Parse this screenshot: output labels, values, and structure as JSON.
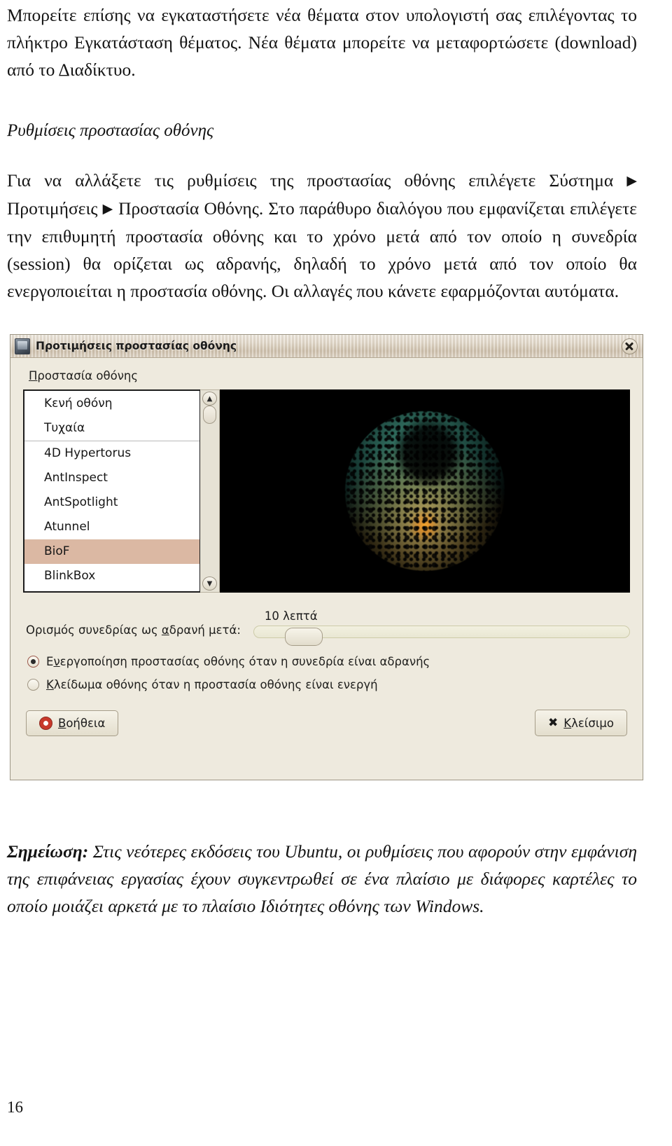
{
  "document": {
    "paragraph_1": "Μπορείτε επίσης να εγκαταστήσετε νέα θέματα στον υπολογιστή σας επιλέγοντας το πλήκτρο Εγκατάσταση θέματος. Νέα θέματα μπορείτε να μεταφορτώσετε (download) από το Διαδίκτυο.",
    "heading": "Ρυθμίσεις προστασίας οθόνης",
    "paragraph_2_a": "Για να αλλάξετε τις ρυθμίσεις της προστασίας οθόνης επιλέγετε Σύστημα",
    "arrow_1": "▶",
    "paragraph_2_b": "Προτιμήσεις",
    "arrow_2": "▶",
    "paragraph_2_c": "Προστασία Οθόνης. Στο παράθυρο διαλόγου που εμφανίζεται επιλέγετε την επιθυμητή προστασία οθόνης και το χρόνο μετά από τον οποίο η συνεδρία (session) θα ορίζεται ως αδρανής, δηλαδή το χρόνο μετά από τον οποίο θα ενεργοποιείται η προστασία οθόνης. Οι αλλαγές που κάνετε εφαρμόζονται αυτόματα.",
    "note_label": "Σημείωση:",
    "note_body": "Στις νεότερες εκδόσεις του Ubuntu, οι ρυθμίσεις που αφορούν στην εμφάνιση της επιφάνειας εργασίας έχουν συγκεντρωθεί σε ένα πλαίσιο με διάφορες καρτέλες το οποίο μοιάζει αρκετά με το πλαίσιο Ιδιότητες οθόνης των Windows.",
    "page_number": "16"
  },
  "dialog": {
    "title": "Προτιμήσεις προστασίας οθόνης",
    "window_icon": "screensaver-icon",
    "close_icon": "✕",
    "group_label": "Προστασία οθόνης",
    "screensaver_list": [
      {
        "label": "Κενή οθόνη",
        "selected": false,
        "separator_after": false
      },
      {
        "label": "Τυχαία",
        "selected": false,
        "separator_after": true
      },
      {
        "label": "4D Hypertorus",
        "selected": false,
        "separator_after": false
      },
      {
        "label": "AntInspect",
        "selected": false,
        "separator_after": false
      },
      {
        "label": "AntSpotlight",
        "selected": false,
        "separator_after": false
      },
      {
        "label": "Atunnel",
        "selected": false,
        "separator_after": false
      },
      {
        "label": "BioF",
        "selected": true,
        "separator_after": false
      },
      {
        "label": "BlinkBox",
        "selected": false,
        "separator_after": false
      }
    ],
    "scroll_up_icon": "▲",
    "scroll_down_icon": "▼",
    "preview_label": "screensaver-preview",
    "idle_label": "Ορισμός συνεδρίας ως αδρανή μετά:",
    "idle_value": "10 λεπτά",
    "option_activate": "Ενεργοποίηση προστασίας οθόνης όταν η συνεδρία είναι αδρανής",
    "option_lock": "Κλείδωμα οθόνης όταν η προστασία οθόνης είναι ενεργή",
    "help_button": "Βοήθεια",
    "close_button": "Κλείσιμο",
    "close_button_icon": "✖",
    "colors": {
      "window_bg": "#eeeade",
      "selection": "#dbb8a3",
      "titlebar": "#d9cfbe",
      "preview_bg": "#000000"
    }
  }
}
